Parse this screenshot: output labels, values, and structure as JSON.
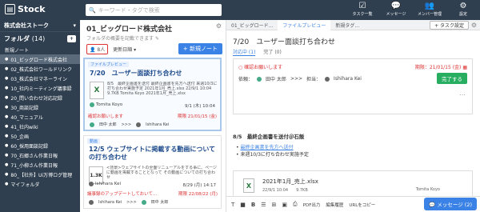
{
  "app": {
    "name": "Stock"
  },
  "search": {
    "placeholder": "キーワード・タグで検索"
  },
  "top_icons": [
    {
      "icon": "check-icon",
      "label": "タスク一覧"
    },
    {
      "icon": "chat-icon",
      "label": "メッセージ"
    },
    {
      "icon": "people-icon",
      "label": "メンバー管理"
    },
    {
      "icon": "gear-icon",
      "label": "設定"
    }
  ],
  "sidebar": {
    "workspace": "株式会社ストーク",
    "folders_label": "フォルダ",
    "folders_count": "(14)",
    "add_label": "+",
    "new_note": "新規ノート",
    "items": [
      "01_ビッグロード株式会社",
      "02_株式会社ワールドリンク",
      "03_株式会社マネーライン",
      "10_社内ミーティング議事録",
      "20_問い合わせ対応記録",
      "30_商談記録",
      "40_マニュアル",
      "41_社内wiki",
      "50_企画",
      "60_採用面談記録",
      "70_石郷さん作業日報",
      "71_小柳さん作業日報",
      "80_【社外】Ui万博ログ管理",
      "マイフォルダ"
    ]
  },
  "list": {
    "title": "01_ビッグロード株式会社",
    "subtitle": "フォルダの概要を記載できます",
    "member_count": "8人",
    "sort": "更新日順",
    "new_note_btn": "+ 新規ノート",
    "cards": [
      {
        "tag": "ファイルプレビュー",
        "title": "7/20　ユーザー面談打ち合わせ",
        "excerpt": "8/5　最終企画書を送付 最終企画書を先方へ送付 来週10/3に打ち合わせ実施予定 2021年1月_売上.xlsx 22/9/1 10:04 9.7KB Tomita Koyo 2021年1月_売上.xlsx",
        "author": "Tomita Koyo",
        "date": "9/1 (木) 10:04",
        "task_label": "確認お願いします",
        "task_due": "期限 21/01/15 (金)",
        "assignee": "田中 太郎",
        "from": "Ishihara Kei"
      },
      {
        "tag": "動画",
        "title": "12/5 ウェブサイトに掲載する動画についての打ち合わせ",
        "excerpt": "<背景>ウェブサイトの全面リニューアルをする事に。ページに動画を掲載することとなって その動画についての打ち合わせ",
        "author": "Ishihara Kei",
        "date": "8/29 (月) 14:17",
        "task_label": "議事録のアップデートしておいて...",
        "task_due": "期限 22/08/22 (月)",
        "assignee": "Ishihara Kei",
        "from": "田中 太郎"
      }
    ]
  },
  "detail": {
    "tabs": [
      "01_ビッグロード...",
      "ファイルプレビュー",
      "新規タグ..."
    ],
    "add_task": "+ タスク設定",
    "title": "7/20　ユーザー面談打ち合わせ",
    "subtabs": [
      "対応中 (1)",
      "完了 (0)"
    ],
    "task": {
      "label": "確認お願いします",
      "due": "期限：21/01/15 (金)",
      "requester_label": "依頼：",
      "requester": "田中 太郎",
      "arrow": ">>>",
      "assignee_label": "担当：",
      "assignee": "Ishihara Kei",
      "done": "完了する"
    },
    "body_heading": "8/5　最終企画書を送付＠石飯",
    "bullets": [
      "最終企画書を先方へ送付",
      "来週10/3に打ち合わせ実施予定"
    ],
    "attachment": {
      "name": "2021年1月_売上.xlsx",
      "meta": "22/9/1 10:04　　9.7KB",
      "owner": "Tomita Koyo"
    },
    "editbar": [
      "PDF出力",
      "編集履歴",
      "URLをコピー"
    ],
    "message_btn": "メッセージ (2)"
  }
}
